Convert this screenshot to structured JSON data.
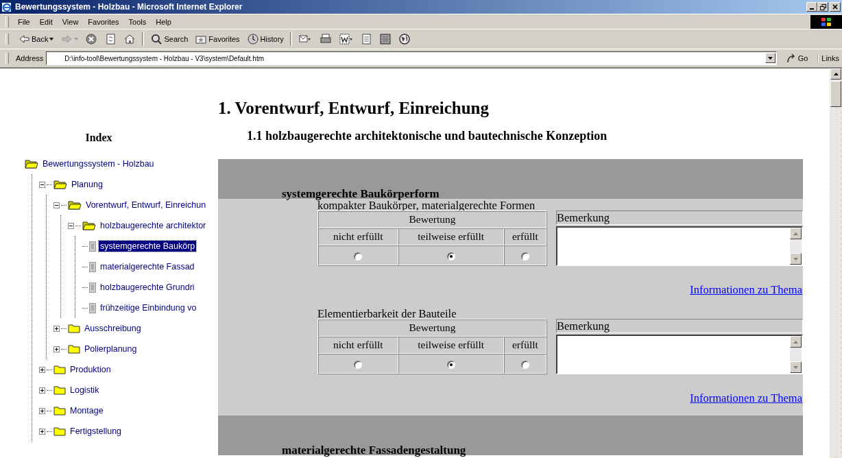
{
  "window": {
    "title": "Bewertungssystem - Holzbau - Microsoft Internet Explorer"
  },
  "menu": [
    "File",
    "Edit",
    "View",
    "Favorites",
    "Tools",
    "Help"
  ],
  "toolbar": [
    {
      "kind": "back",
      "label": "Back"
    },
    {
      "kind": "forward"
    },
    {
      "kind": "stop"
    },
    {
      "kind": "refresh"
    },
    {
      "kind": "home"
    },
    {
      "kind": "search",
      "label": "Search"
    },
    {
      "kind": "favorites",
      "label": "Favorites"
    },
    {
      "kind": "history",
      "label": "History"
    },
    {
      "kind": "mail"
    },
    {
      "kind": "print"
    },
    {
      "kind": "edit"
    },
    {
      "kind": "discuss"
    },
    {
      "kind": "messenger"
    },
    {
      "kind": "globe"
    }
  ],
  "address": {
    "label": "Address",
    "value": "D:\\info-tool\\Bewertungssystem - Holzbau - V3\\system\\Default.htm",
    "go": "Go",
    "links": "Links"
  },
  "index": {
    "title": "Index",
    "tree": [
      {
        "label": "Bewertungssystem - Holzbau",
        "kind": "folder",
        "expanded": true,
        "selected": false,
        "children": [
          {
            "label": "Planung",
            "kind": "folder",
            "expanded": true,
            "selected": false,
            "children": [
              {
                "label": "Vorentwurf, Entwurf, Einreichun",
                "kind": "folder",
                "expanded": true,
                "selected": false,
                "children": [
                  {
                    "label": "holzbaugerechte architektor",
                    "kind": "folder",
                    "expanded": true,
                    "selected": false,
                    "children": [
                      {
                        "label": "systemgerechte Baukörp",
                        "kind": "page",
                        "selected": true
                      },
                      {
                        "label": "materialgerechte Fassad",
                        "kind": "page",
                        "selected": false
                      },
                      {
                        "label": "holzbaugerechte Grundri",
                        "kind": "page",
                        "selected": false
                      },
                      {
                        "label": "frühzeitige Einbindung vo",
                        "kind": "page",
                        "selected": false
                      }
                    ]
                  }
                ]
              },
              {
                "label": "Ausschreibung",
                "kind": "folder",
                "expanded": false,
                "selected": false
              },
              {
                "label": "Polierplanung",
                "kind": "folder",
                "expanded": false,
                "selected": false
              }
            ]
          },
          {
            "label": "Produktion",
            "kind": "folder",
            "expanded": false,
            "selected": false
          },
          {
            "label": "Logistik",
            "kind": "folder",
            "expanded": false,
            "selected": false
          },
          {
            "label": "Montage",
            "kind": "folder",
            "expanded": false,
            "selected": false
          },
          {
            "label": "Fertigstellung",
            "kind": "folder",
            "expanded": false,
            "selected": false
          }
        ]
      }
    ]
  },
  "page": {
    "heading": "1. Vorentwurf, Entwurf, Einreichung",
    "subheading": "1.1 holzbaugerechte architektonische und bautechnische Konzeption",
    "sections": [
      {
        "title": "systemgerechte Baukörperform",
        "criteria": [
          {
            "label": "kompakter Baukörper, materialgerechte Formen",
            "rating_header": "Bewertung",
            "options": [
              {
                "label": "nicht erfüllt",
                "selected": false
              },
              {
                "label": "teilweise erfüllt",
                "selected": true
              },
              {
                "label": "erfüllt",
                "selected": false
              }
            ],
            "remark_header": "Bemerkung",
            "link": "Informationen zu Thema"
          },
          {
            "label": "Elementierbarkeit der Bauteile",
            "rating_header": "Bewertung",
            "options": [
              {
                "label": "nicht erfüllt",
                "selected": false
              },
              {
                "label": "teilweise erfüllt",
                "selected": true
              },
              {
                "label": "erfüllt",
                "selected": false
              }
            ],
            "remark_header": "Bemerkung",
            "link": "Informationen zu Thema"
          }
        ]
      },
      {
        "title": "materialgerechte Fassadengestaltung"
      }
    ]
  }
}
